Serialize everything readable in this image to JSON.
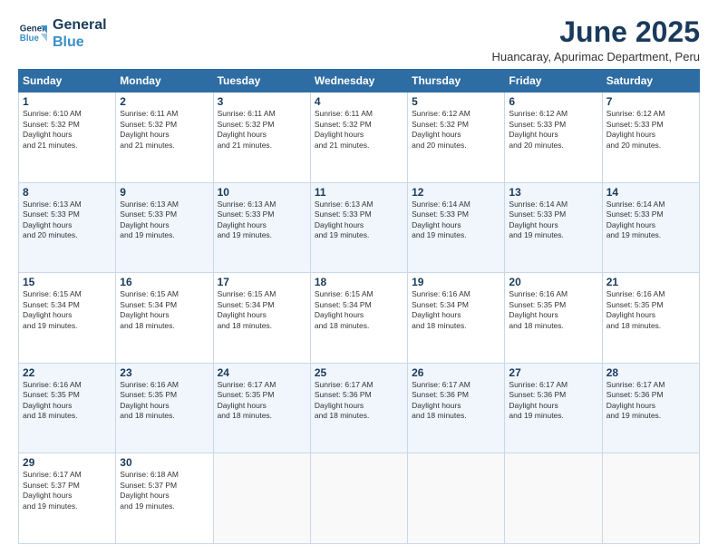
{
  "header": {
    "logo_line1": "General",
    "logo_line2": "Blue",
    "month": "June 2025",
    "location": "Huancaray, Apurimac Department, Peru"
  },
  "weekdays": [
    "Sunday",
    "Monday",
    "Tuesday",
    "Wednesday",
    "Thursday",
    "Friday",
    "Saturday"
  ],
  "weeks": [
    [
      {
        "day": "1",
        "sunrise": "6:10 AM",
        "sunset": "5:32 PM",
        "daylight": "11 hours and 21 minutes."
      },
      {
        "day": "2",
        "sunrise": "6:11 AM",
        "sunset": "5:32 PM",
        "daylight": "11 hours and 21 minutes."
      },
      {
        "day": "3",
        "sunrise": "6:11 AM",
        "sunset": "5:32 PM",
        "daylight": "11 hours and 21 minutes."
      },
      {
        "day": "4",
        "sunrise": "6:11 AM",
        "sunset": "5:32 PM",
        "daylight": "11 hours and 21 minutes."
      },
      {
        "day": "5",
        "sunrise": "6:12 AM",
        "sunset": "5:32 PM",
        "daylight": "11 hours and 20 minutes."
      },
      {
        "day": "6",
        "sunrise": "6:12 AM",
        "sunset": "5:33 PM",
        "daylight": "11 hours and 20 minutes."
      },
      {
        "day": "7",
        "sunrise": "6:12 AM",
        "sunset": "5:33 PM",
        "daylight": "11 hours and 20 minutes."
      }
    ],
    [
      {
        "day": "8",
        "sunrise": "6:13 AM",
        "sunset": "5:33 PM",
        "daylight": "11 hours and 20 minutes."
      },
      {
        "day": "9",
        "sunrise": "6:13 AM",
        "sunset": "5:33 PM",
        "daylight": "11 hours and 19 minutes."
      },
      {
        "day": "10",
        "sunrise": "6:13 AM",
        "sunset": "5:33 PM",
        "daylight": "11 hours and 19 minutes."
      },
      {
        "day": "11",
        "sunrise": "6:13 AM",
        "sunset": "5:33 PM",
        "daylight": "11 hours and 19 minutes."
      },
      {
        "day": "12",
        "sunrise": "6:14 AM",
        "sunset": "5:33 PM",
        "daylight": "11 hours and 19 minutes."
      },
      {
        "day": "13",
        "sunrise": "6:14 AM",
        "sunset": "5:33 PM",
        "daylight": "11 hours and 19 minutes."
      },
      {
        "day": "14",
        "sunrise": "6:14 AM",
        "sunset": "5:33 PM",
        "daylight": "11 hours and 19 minutes."
      }
    ],
    [
      {
        "day": "15",
        "sunrise": "6:15 AM",
        "sunset": "5:34 PM",
        "daylight": "11 hours and 19 minutes."
      },
      {
        "day": "16",
        "sunrise": "6:15 AM",
        "sunset": "5:34 PM",
        "daylight": "11 hours and 18 minutes."
      },
      {
        "day": "17",
        "sunrise": "6:15 AM",
        "sunset": "5:34 PM",
        "daylight": "11 hours and 18 minutes."
      },
      {
        "day": "18",
        "sunrise": "6:15 AM",
        "sunset": "5:34 PM",
        "daylight": "11 hours and 18 minutes."
      },
      {
        "day": "19",
        "sunrise": "6:16 AM",
        "sunset": "5:34 PM",
        "daylight": "11 hours and 18 minutes."
      },
      {
        "day": "20",
        "sunrise": "6:16 AM",
        "sunset": "5:35 PM",
        "daylight": "11 hours and 18 minutes."
      },
      {
        "day": "21",
        "sunrise": "6:16 AM",
        "sunset": "5:35 PM",
        "daylight": "11 hours and 18 minutes."
      }
    ],
    [
      {
        "day": "22",
        "sunrise": "6:16 AM",
        "sunset": "5:35 PM",
        "daylight": "11 hours and 18 minutes."
      },
      {
        "day": "23",
        "sunrise": "6:16 AM",
        "sunset": "5:35 PM",
        "daylight": "11 hours and 18 minutes."
      },
      {
        "day": "24",
        "sunrise": "6:17 AM",
        "sunset": "5:35 PM",
        "daylight": "11 hours and 18 minutes."
      },
      {
        "day": "25",
        "sunrise": "6:17 AM",
        "sunset": "5:36 PM",
        "daylight": "11 hours and 18 minutes."
      },
      {
        "day": "26",
        "sunrise": "6:17 AM",
        "sunset": "5:36 PM",
        "daylight": "11 hours and 18 minutes."
      },
      {
        "day": "27",
        "sunrise": "6:17 AM",
        "sunset": "5:36 PM",
        "daylight": "11 hours and 19 minutes."
      },
      {
        "day": "28",
        "sunrise": "6:17 AM",
        "sunset": "5:36 PM",
        "daylight": "11 hours and 19 minutes."
      }
    ],
    [
      {
        "day": "29",
        "sunrise": "6:17 AM",
        "sunset": "5:37 PM",
        "daylight": "11 hours and 19 minutes."
      },
      {
        "day": "30",
        "sunrise": "6:18 AM",
        "sunset": "5:37 PM",
        "daylight": "11 hours and 19 minutes."
      },
      null,
      null,
      null,
      null,
      null
    ]
  ]
}
